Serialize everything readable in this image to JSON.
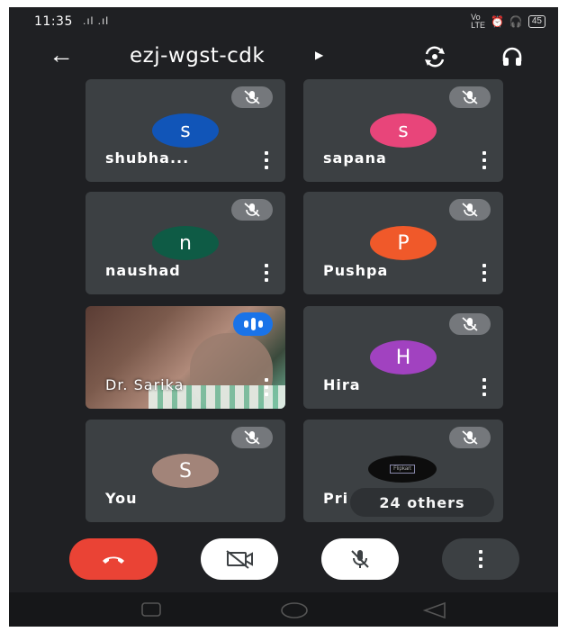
{
  "status_bar": {
    "time": "11:35",
    "signal": ".ıl .ıl",
    "battery": "45"
  },
  "header": {
    "meeting_code": "ezj-wgst-cdk"
  },
  "participants": [
    {
      "name": "shubha...",
      "initial": "s",
      "color": "#1155b8",
      "muted": true
    },
    {
      "name": "sapana",
      "initial": "s",
      "color": "#e8457a",
      "muted": true
    },
    {
      "name": "naushad",
      "initial": "n",
      "color": "#0e5b45",
      "muted": true
    },
    {
      "name": "Pushpa",
      "initial": "P",
      "color": "#f0592a",
      "muted": true
    },
    {
      "name": "Dr. Sarika",
      "video": true,
      "speaking": true
    },
    {
      "name": "Hira",
      "initial": "H",
      "color": "#a142c0",
      "muted": true
    },
    {
      "name": "You",
      "initial": "S",
      "color": "#a28479",
      "muted": true
    },
    {
      "name": "Pri",
      "others_label": "24 others",
      "thumb_text": "Flipkart",
      "muted": true
    }
  ],
  "colors": {
    "end_call": "#ea4335",
    "control_light": "#ffffff",
    "control_dark": "#3c4043",
    "background": "#1f2023"
  }
}
